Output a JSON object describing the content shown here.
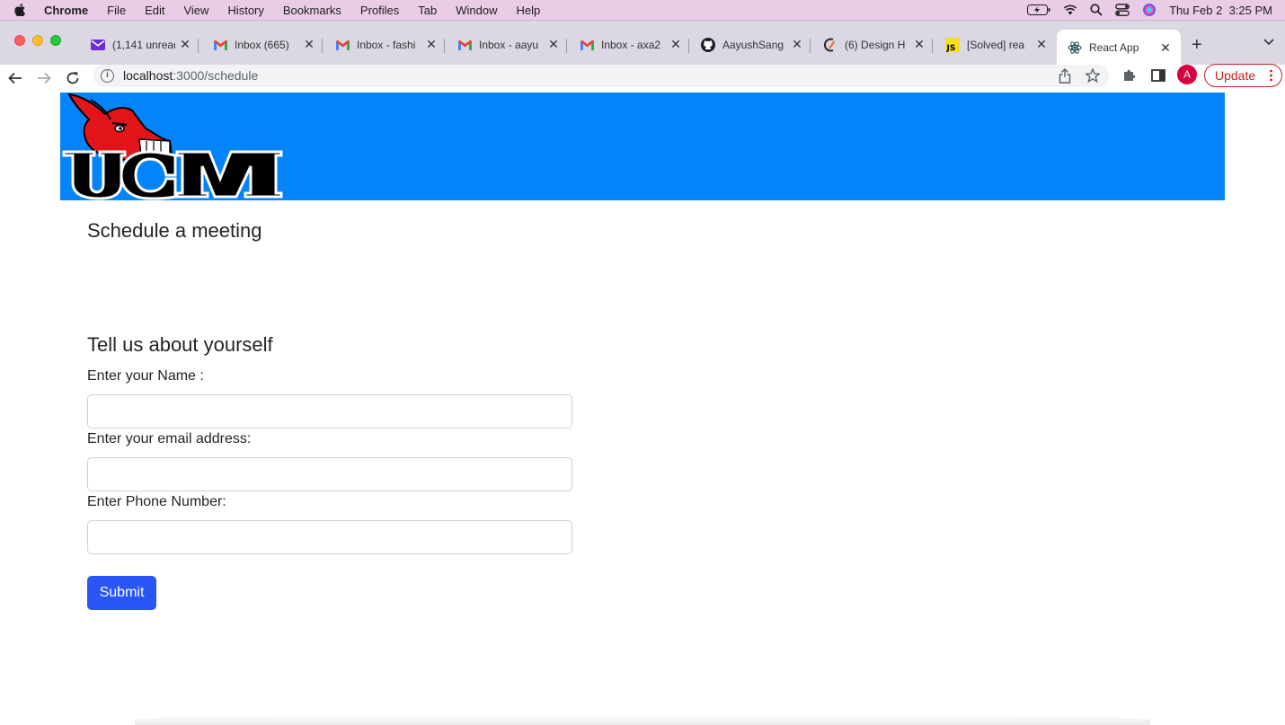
{
  "menubar": {
    "app": "Chrome",
    "items": [
      "File",
      "Edit",
      "View",
      "History",
      "Bookmarks",
      "Profiles",
      "Tab",
      "Window",
      "Help"
    ],
    "datetime": "Thu Feb 2  3:25 PM"
  },
  "tabs": [
    {
      "title": "(1,141 unread",
      "icon": "mail-icon"
    },
    {
      "title": "Inbox (665)",
      "icon": "gmail-icon"
    },
    {
      "title": "Inbox - fashi",
      "icon": "gmail-icon"
    },
    {
      "title": "Inbox - aayu",
      "icon": "gmail-icon"
    },
    {
      "title": "Inbox - axa2",
      "icon": "gmail-icon"
    },
    {
      "title": "AayushSang",
      "icon": "github-icon"
    },
    {
      "title": "(6) Design H",
      "icon": "design-icon"
    },
    {
      "title": "[Solved] rea",
      "icon": "js-icon"
    },
    {
      "title": "React App",
      "icon": "react-icon",
      "active": true
    }
  ],
  "address": {
    "host": "localhost",
    "path": ":3000/schedule"
  },
  "toolbar": {
    "profile_initial": "A",
    "update_label": "Update"
  },
  "page": {
    "heading": "Schedule a meeting",
    "form_heading": "Tell us about yourself",
    "name_label": "Enter your Name :",
    "email_label": "Enter your email address:",
    "phone_label": "Enter Phone Number:",
    "name_value": "",
    "email_value": "",
    "phone_value": "",
    "submit_label": "Submit"
  },
  "colors": {
    "banner": "#0384fa",
    "submit": "#2955f5",
    "menubar": "#e9cde6"
  }
}
